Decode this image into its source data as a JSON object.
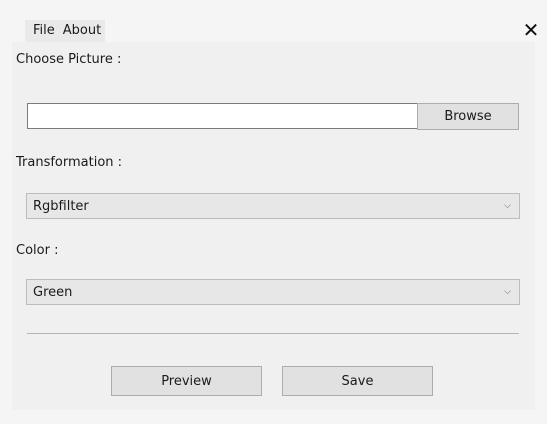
{
  "menu": {
    "file": "File",
    "about": "About"
  },
  "close_icon": "✕",
  "form": {
    "choose_picture_label": "Choose Picture :",
    "picture_path_value": "",
    "browse_label": "Browse",
    "transformation_label": "Transformation :",
    "transformation_selected": "Rgbfilter",
    "color_label": "Color :",
    "color_selected": "Green"
  },
  "actions": {
    "preview_label": "Preview",
    "save_label": "Save"
  },
  "icons": {
    "dropdown": "chevron-down-icon",
    "close": "close-icon"
  }
}
